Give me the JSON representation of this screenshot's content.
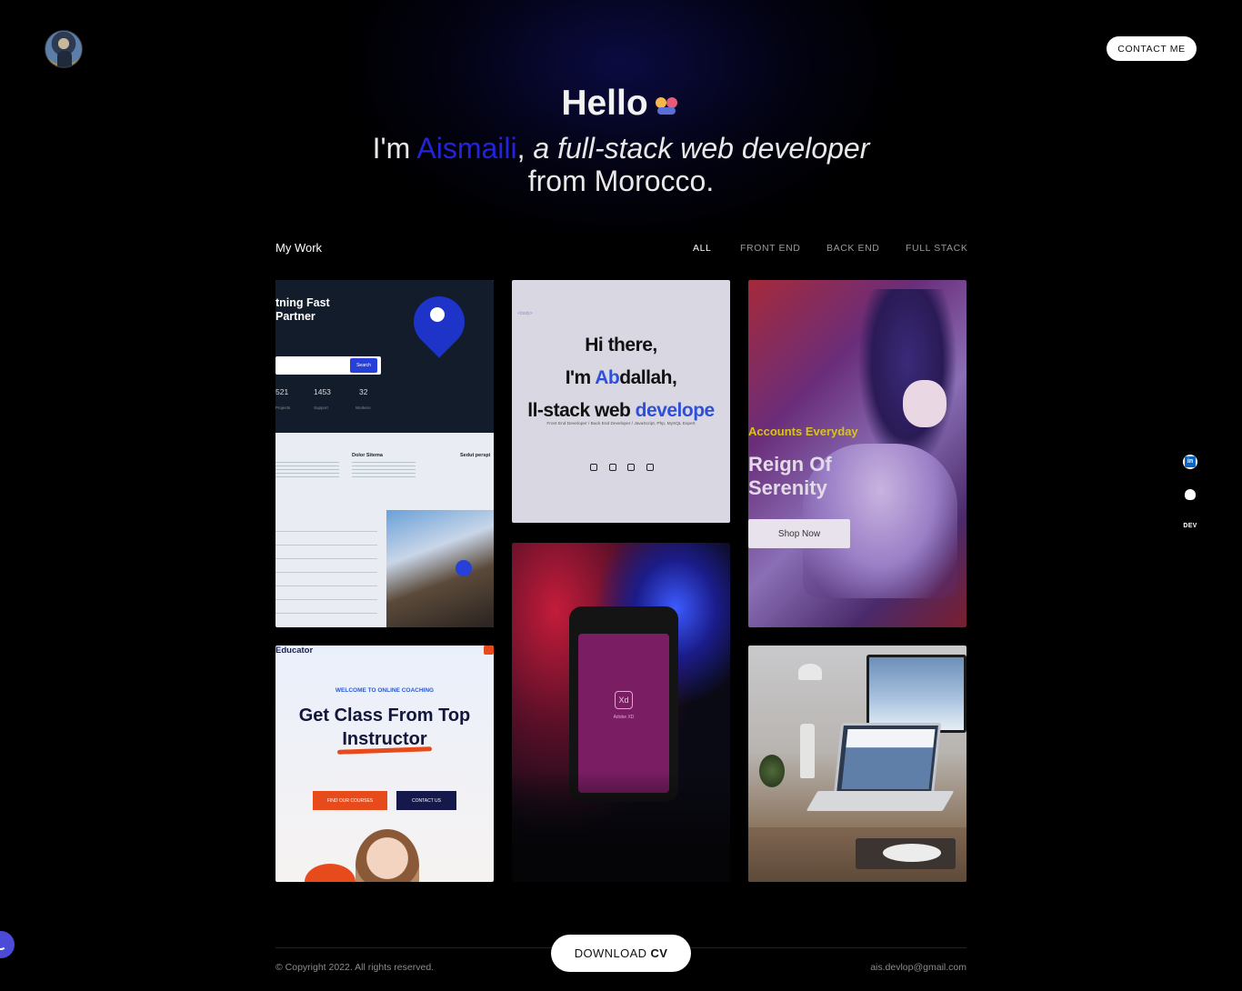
{
  "header": {
    "avatar_icon": "user-avatar",
    "contact_label": "CONTACT ME"
  },
  "hero": {
    "hello": "Hello",
    "wave_icon": "people-emoji",
    "im": "I'm ",
    "name": "Aismaili",
    "comma": ", ",
    "role": "a full-stack web developer",
    "line2": "from Morocco."
  },
  "work": {
    "title": "My Work",
    "filters": [
      "ALL",
      "FRONT END",
      "BACK END",
      "FULL STACK"
    ],
    "active_filter": "ALL"
  },
  "projects": [
    {
      "name": "lightning-fast-partner",
      "heading1": "tning Fast",
      "heading2": "Partner",
      "search_label": "Search",
      "stats": [
        "521",
        "1453",
        "32"
      ],
      "stat_labels": [
        "Projects",
        "Support",
        "Workers"
      ],
      "features": [
        "Dolor Sitema",
        "Sedut perspi"
      ]
    },
    {
      "name": "abdallah-portfolio",
      "line1": "Hi there,",
      "line2_pre": "I'm ",
      "line2_a": "Ab",
      "line2_post": "dallah,",
      "line3_pre": "ll-stack ",
      "line3_k": "k",
      "line3_web": " web ",
      "line3_post": "develope",
      "subtitle": "Front End Developer / Back End Developer / JavaScript, Php, MySQL Expert"
    },
    {
      "name": "reign-of-serenity",
      "accent": "Accounts Everyday",
      "title1": "Reign Of",
      "title2": "Serenity",
      "button": "Shop Now"
    },
    {
      "name": "educator",
      "brand": "Educator",
      "welcome": "WELCOME TO ONLINE COACHING",
      "heading1": "Get Class From Top",
      "heading2": "Instructor",
      "button1": "FIND OUR COURSES",
      "button2": "CONTACT US"
    },
    {
      "name": "adobe-xd-phone",
      "app_icon": "Xd",
      "app_label": "Adobe XD"
    },
    {
      "name": "workspace-laptop"
    }
  ],
  "social": {
    "linkedin_icon": "linkedin-icon",
    "github_icon": "github-icon",
    "dev_label": "DEV"
  },
  "footer": {
    "download_label": "DOWNLOAD",
    "download_bold": "CV",
    "copyright": "© Copyright 2022. All rights reserved.",
    "email": "ais.devlop@gmail.com"
  },
  "colors": {
    "accent": "#2323d9",
    "background": "#000000"
  }
}
